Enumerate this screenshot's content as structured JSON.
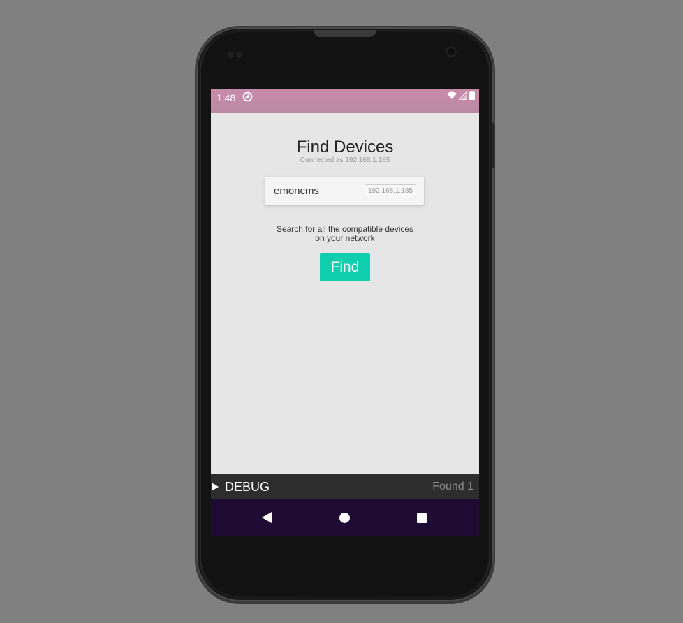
{
  "status_bar": {
    "time": "1:48",
    "app_icon": "sync-icon",
    "icons": [
      "wifi-icon",
      "signal-icon",
      "battery-icon"
    ]
  },
  "page": {
    "title": "Find Devices",
    "subtitle": "Connected as 192.168.1.185"
  },
  "device": {
    "name": "emoncms",
    "ip": "192.168.1.185"
  },
  "help_text": "Search for all the compatible devices on your network",
  "find_button": {
    "label": "Find",
    "color": "#0fcfae"
  },
  "debug_bar": {
    "label": "DEBUG",
    "status": "Found 1"
  },
  "nav_bar": {
    "icons": [
      "back-icon",
      "home-icon",
      "recents-icon"
    ]
  },
  "colors": {
    "status_bar": "#c98aab",
    "nav_bar": "#1f0a33",
    "screen_bg": "#e6e6e6",
    "debug_bg": "#2d2d2d"
  }
}
